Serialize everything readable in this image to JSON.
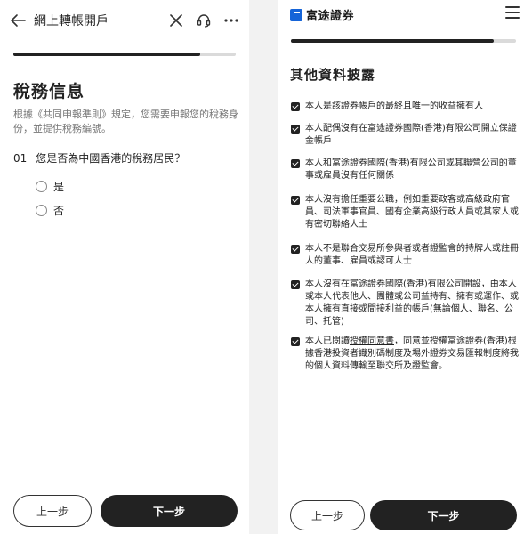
{
  "left": {
    "header": {
      "back_icon": "arrow-left-icon",
      "title": "網上轉帳開戶",
      "close_icon": "close-icon",
      "support_icon": "headset-icon",
      "more_icon": "more-horizontal-icon"
    },
    "progress": 0.84,
    "heading": "稅務信息",
    "description": "根據《共同申報準則》規定，您需要申報您的稅務身份，並提供稅務編號。",
    "question": {
      "number": "01",
      "text": "您是否為中國香港的稅務居民？"
    },
    "options": [
      "是",
      "否"
    ],
    "buttons": {
      "prev": "上一步",
      "next": "下一步"
    }
  },
  "right": {
    "logo_text": "富途證券",
    "menu_icon": "hamburger-menu-icon",
    "progress": 0.9,
    "heading": "其他資料披露",
    "acknowledgements": [
      "本人是該證券帳戶的最終且唯一的收益擁有人",
      "本人配偶沒有在富途證券國際(香港)有限公司開立保證金帳戶",
      "本人和富途證券國際(香港)有限公司或其聯營公司的董事或雇員沒有任何關係",
      "本人沒有擔任重要公職，例如重要政客或高級政府官員、司法軍事官員、國有企業高級行政人員或其家人或有密切聯絡人士",
      "本人不是聯合交易所參與者或者證監會的持牌人或註冊人的董事、雇員或認可人士",
      "本人沒有在富途證券國際(香港)有限公司開設，由本人或本人代表他人、團體或公司益持有、擁有或運作、或本人擁有直接或間接利益的帳戶(無論個人、聯名、公司、托管)"
    ],
    "consent": {
      "before": "本人已閱讀",
      "link": "授權同意書",
      "after": "，同意並授權富途證券(香港)根據香港投資者識別碼制度及場外證券交易匯報制度將我的個人資料傳輸至聯交所及證監會。"
    },
    "buttons": {
      "prev": "上一步",
      "next": "下一步"
    }
  }
}
